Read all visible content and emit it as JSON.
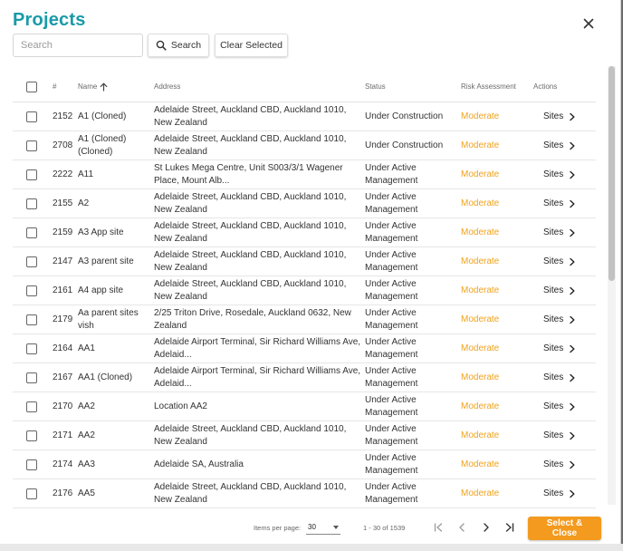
{
  "title": "Projects",
  "search": {
    "placeholder": "Search",
    "value": "",
    "button_label": "Search"
  },
  "clear_selected_label": "Clear Selected",
  "columns": {
    "num": "#",
    "name": "Name",
    "address": "Address",
    "status": "Status",
    "risk": "Risk Assessment",
    "actions": "Actions"
  },
  "sort": {
    "column": "name",
    "direction": "ascending",
    "icon": "arrow-up-icon"
  },
  "rows": [
    {
      "num": "2152",
      "name": "A1 (Cloned)",
      "address": "Adelaide Street, Auckland CBD, Auckland 1010, New Zealand",
      "status": "Under Construction",
      "risk": "Moderate",
      "action": "Sites"
    },
    {
      "num": "2708",
      "name": "A1 (Cloned) (Cloned)",
      "address": "Adelaide Street, Auckland CBD, Auckland 1010, New Zealand",
      "status": "Under Construction",
      "risk": "Moderate",
      "action": "Sites"
    },
    {
      "num": "2222",
      "name": "A11",
      "address": "St Lukes Mega Centre, Unit S003/3/1 Wagener Place, Mount Alb...",
      "status": "Under Active Management",
      "risk": "Moderate",
      "action": "Sites"
    },
    {
      "num": "2155",
      "name": "A2",
      "address": "Adelaide Street, Auckland CBD, Auckland 1010, New Zealand",
      "status": "Under Active Management",
      "risk": "Moderate",
      "action": "Sites"
    },
    {
      "num": "2159",
      "name": "A3 App site",
      "address": "Adelaide Street, Auckland CBD, Auckland 1010, New Zealand",
      "status": "Under Active Management",
      "risk": "Moderate",
      "action": "Sites"
    },
    {
      "num": "2147",
      "name": "A3 parent site",
      "address": "Adelaide Street, Auckland CBD, Auckland 1010, New Zealand",
      "status": "Under Active Management",
      "risk": "Moderate",
      "action": "Sites"
    },
    {
      "num": "2161",
      "name": "A4 app site",
      "address": "Adelaide Street, Auckland CBD, Auckland 1010, New Zealand",
      "status": "Under Active Management",
      "risk": "Moderate",
      "action": "Sites"
    },
    {
      "num": "2179",
      "name": "Aa parent sites vish",
      "address": "2/25 Triton Drive, Rosedale, Auckland 0632, New Zealand",
      "status": "Under Active Management",
      "risk": "Moderate",
      "action": "Sites"
    },
    {
      "num": "2164",
      "name": "AA1",
      "address": "Adelaide Airport Terminal, Sir Richard Williams Ave, Adelaid...",
      "status": "Under Active Management",
      "risk": "Moderate",
      "action": "Sites"
    },
    {
      "num": "2167",
      "name": "AA1 (Cloned)",
      "address": "Adelaide Airport Terminal, Sir Richard Williams Ave, Adelaid...",
      "status": "Under Active Management",
      "risk": "Moderate",
      "action": "Sites"
    },
    {
      "num": "2170",
      "name": "AA2",
      "address": "Location AA2",
      "status": "Under Active Management",
      "risk": "Moderate",
      "action": "Sites"
    },
    {
      "num": "2171",
      "name": "AA2",
      "address": "Adelaide Street, Auckland CBD, Auckland 1010, New Zealand",
      "status": "Under Active Management",
      "risk": "Moderate",
      "action": "Sites"
    },
    {
      "num": "2174",
      "name": "AA3",
      "address": "Adelaide SA, Australia",
      "status": "Under Active Management",
      "risk": "Moderate",
      "action": "Sites"
    },
    {
      "num": "2176",
      "name": "AA5",
      "address": "Adelaide Street, Auckland CBD, Auckland 1010, New Zealand",
      "status": "Under Active Management",
      "risk": "Moderate",
      "action": "Sites"
    }
  ],
  "footer": {
    "items_per_page_label": "Items per page:",
    "items_per_page_value": "30",
    "range_label": "1 - 30 of 1539",
    "select_close_label": "Select & Close"
  },
  "colors": {
    "title": "#1a9aa8",
    "risk_moderate": "#f0a21a",
    "primary_button": "#f39a1f"
  }
}
